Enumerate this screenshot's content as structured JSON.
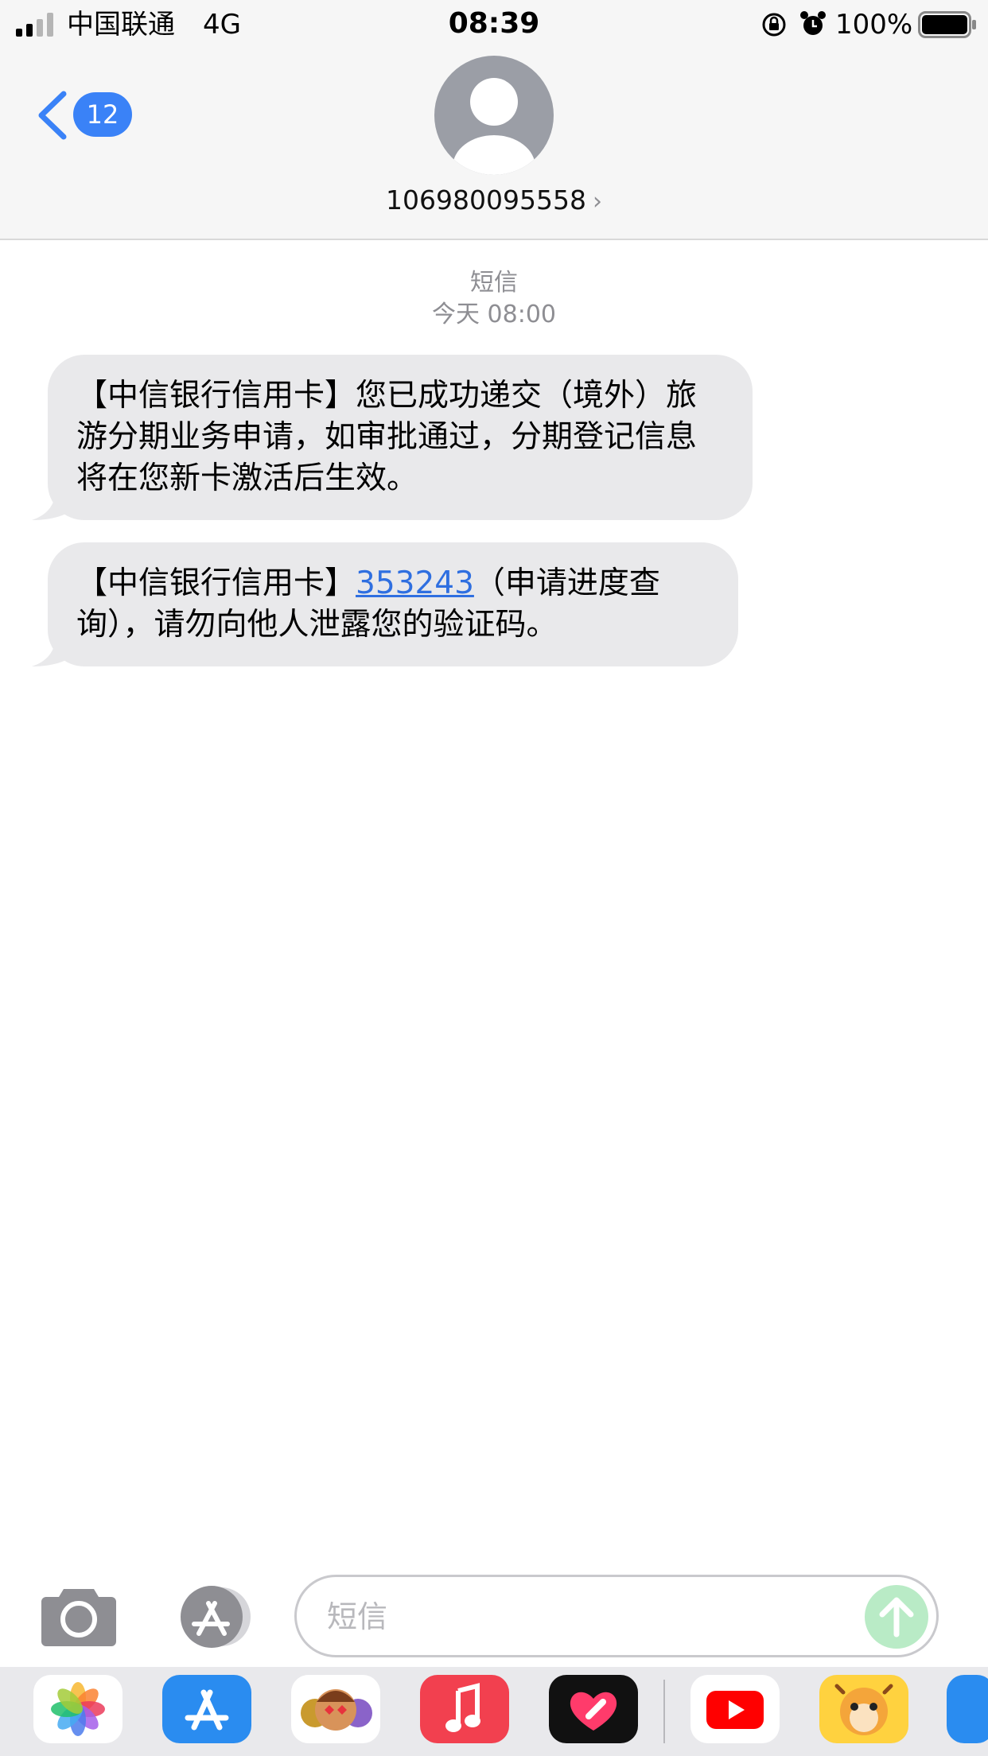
{
  "status_bar": {
    "carrier": "中国联通",
    "network": "4G",
    "time": "08:39",
    "battery_percent": "100%",
    "signal_bars_active": 2,
    "signal_bars_total": 4
  },
  "header": {
    "back_badge": "12",
    "contact_number": "106980095558"
  },
  "thread": {
    "service_label": "短信",
    "timestamp": "今天 08:00",
    "messages": [
      {
        "text": "【中信银行信用卡】您已成功递交（境外）旅游分期业务申请，如审批通过，分期登记信息将在您新卡激活后生效。"
      },
      {
        "prefix": "【中信银行信用卡】",
        "code": "353243",
        "suffix": "（申请进度查询），请勿向他人泄露您的验证码。"
      }
    ]
  },
  "compose": {
    "placeholder": "短信"
  },
  "app_drawer": {
    "apps": [
      "photos-icon",
      "app-store-icon",
      "memoji-icon",
      "music-icon",
      "digital-touch-icon",
      "youtube-icon",
      "cartoon-app-icon",
      "partial-app-icon"
    ]
  },
  "colors": {
    "accent": "#3a82f7",
    "bubble": "#e9e9eb",
    "link": "#2f6fe0",
    "send_disabled": "#b9ebc6"
  }
}
